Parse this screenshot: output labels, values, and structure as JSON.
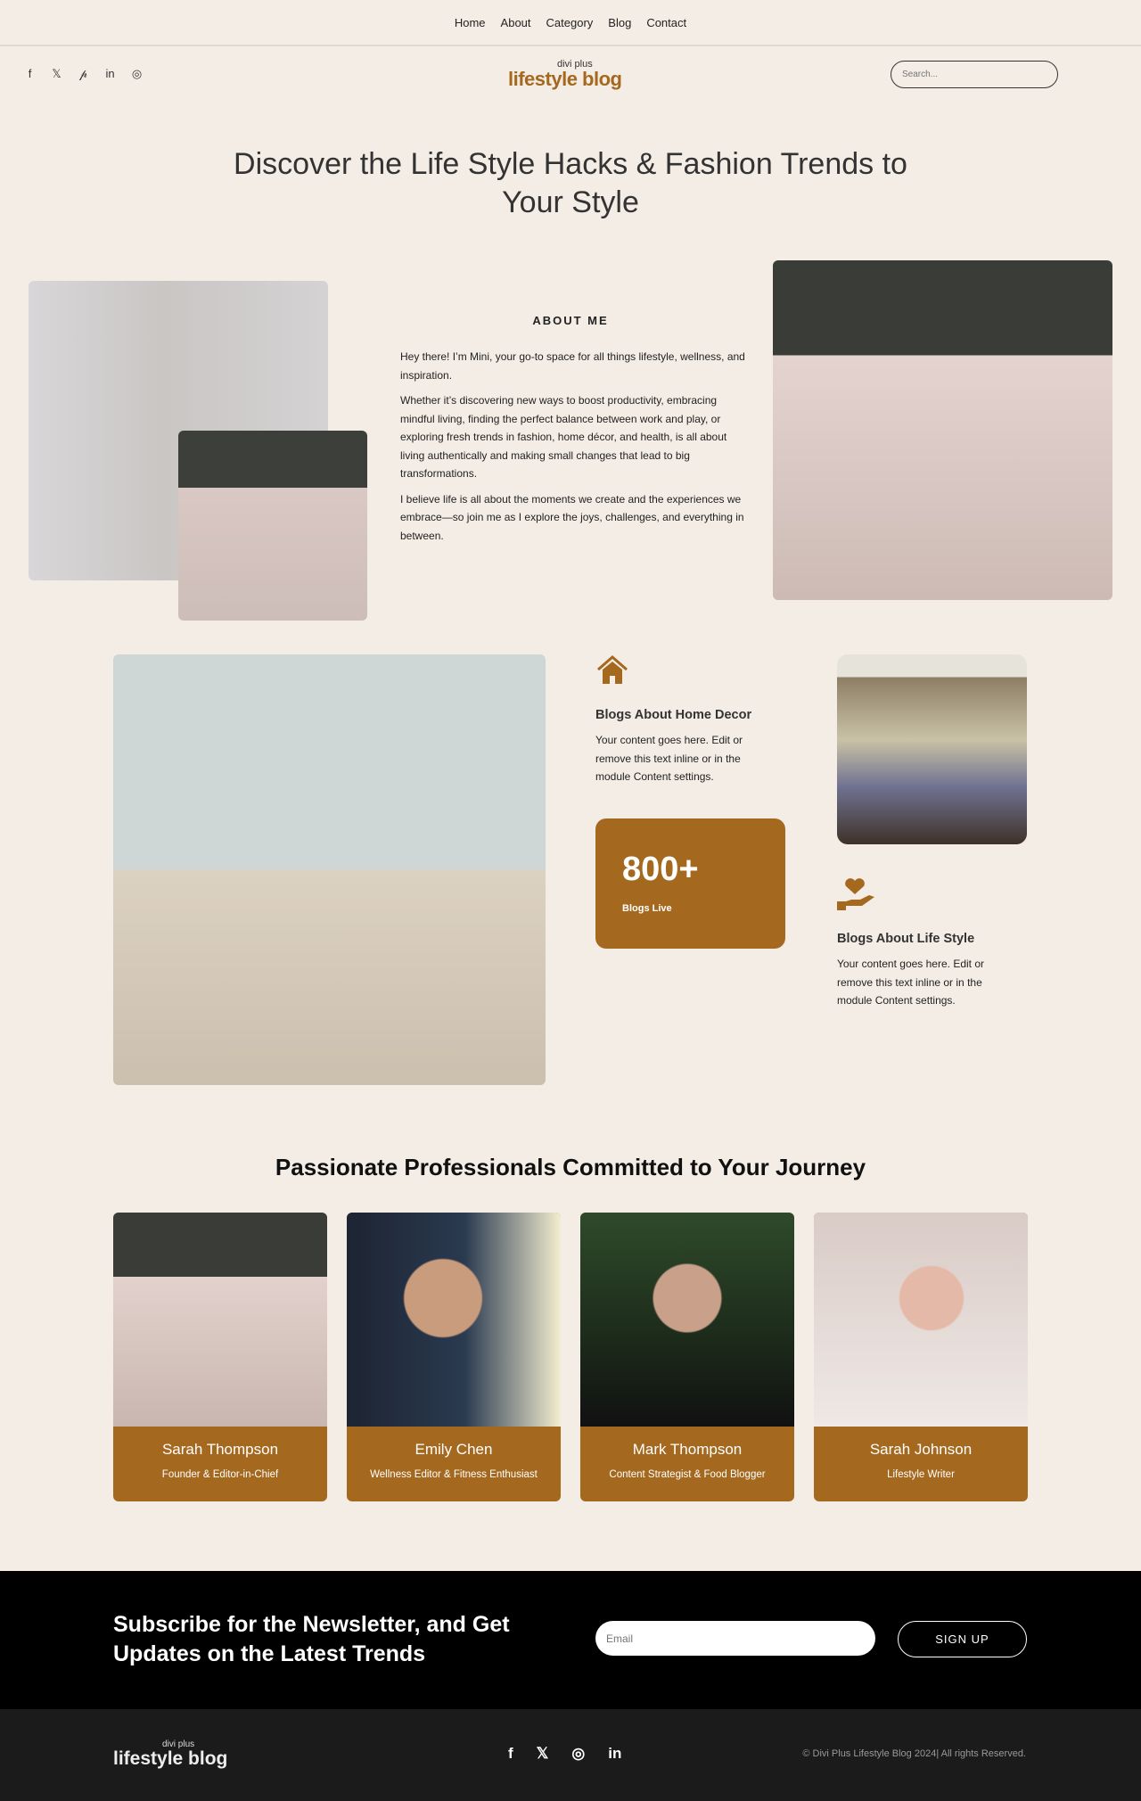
{
  "nav": {
    "items": [
      "Home",
      "About",
      "Category",
      "Blog",
      "Contact"
    ]
  },
  "social": [
    {
      "icon": "facebook-icon",
      "glyph": "f"
    },
    {
      "icon": "x-icon",
      "glyph": "𝕏"
    },
    {
      "icon": "pinterest-icon",
      "glyph": "𝓅"
    },
    {
      "icon": "linkedin-icon",
      "glyph": "in"
    },
    {
      "icon": "instagram-icon",
      "glyph": "◎"
    }
  ],
  "logo": {
    "small": "divi plus",
    "big": "lifestyle blog"
  },
  "search": {
    "placeholder": "Search..."
  },
  "hero": {
    "title": "Discover the Life Style Hacks & Fashion Trends to Your Style"
  },
  "about": {
    "heading": "ABOUT ME",
    "paragraphs": [
      "Hey there! I’m Mini, your go-to space for all things lifestyle, wellness, and inspiration.",
      "Whether it’s discovering new ways to boost productivity, embracing mindful living, finding the perfect balance between work and play, or exploring fresh trends in fashion, home décor, and health, is all about living authentically and making small changes that lead to big transformations.",
      "I believe life is all about the moments we create and the experiences we embrace—so join me as I explore the joys, challenges, and everything in between."
    ]
  },
  "features": [
    {
      "icon": "house-icon",
      "title": "Blogs About Home Decor",
      "text": "Your content goes here. Edit or remove this text inline or in the module Content settings."
    },
    {
      "icon": "heart-hand-icon",
      "title": "Blogs About Life Style",
      "text": "Your content goes here. Edit or remove this text inline or in the module Content settings."
    }
  ],
  "stat": {
    "number": "800+",
    "label": "Blogs Live"
  },
  "team": {
    "heading": "Passionate Professionals Committed to Your Journey",
    "members": [
      {
        "name": "Sarah Thompson",
        "role": "Founder & Editor-in-Chief"
      },
      {
        "name": "Emily Chen",
        "role": "Wellness Editor & Fitness Enthusiast"
      },
      {
        "name": "Mark Thompson",
        "role": "Content Strategist & Food Blogger"
      },
      {
        "name": "Sarah Johnson",
        "role": "Lifestyle Writer"
      }
    ]
  },
  "newsletter": {
    "heading": "Subscribe for the Newsletter, and Get Updates on the Latest Trends",
    "email_placeholder": "Email",
    "button": "SIGN UP"
  },
  "footer": {
    "logo_small": "divi plus",
    "logo_big": "lifestyle blog",
    "icons": [
      {
        "icon": "facebook-icon",
        "glyph": "f"
      },
      {
        "icon": "x-icon",
        "glyph": "𝕏"
      },
      {
        "icon": "instagram-icon",
        "glyph": "◎"
      },
      {
        "icon": "linkedin-icon",
        "glyph": "in"
      }
    ],
    "copyright": "© Divi Plus Lifestyle Blog 2024| All rights Reserved."
  },
  "colors": {
    "accent": "#a4691f",
    "background": "#f4ede5",
    "newsletter_bg": "#000000",
    "footer_bg": "#1b1b1b"
  }
}
